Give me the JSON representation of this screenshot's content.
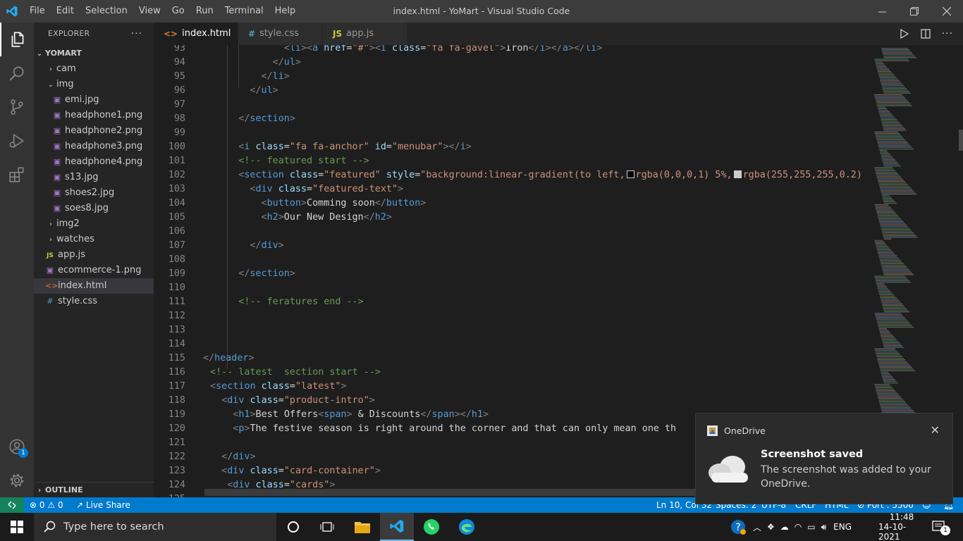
{
  "window": {
    "title": "index.html - YoMart - Visual Studio Code"
  },
  "menu": [
    "File",
    "Edit",
    "Selection",
    "View",
    "Go",
    "Run",
    "Terminal",
    "Help"
  ],
  "explorer": {
    "header": "EXPLORER",
    "project": "YOMART",
    "items": [
      {
        "label": "cam",
        "kind": "folder"
      },
      {
        "label": "img",
        "kind": "folder-open"
      },
      {
        "label": "emi.jpg",
        "kind": "image"
      },
      {
        "label": "headphone1.png",
        "kind": "image"
      },
      {
        "label": "headphone2.png",
        "kind": "image"
      },
      {
        "label": "headphone3.png",
        "kind": "image"
      },
      {
        "label": "headphone4.png",
        "kind": "image"
      },
      {
        "label": "s13.jpg",
        "kind": "image"
      },
      {
        "label": "shoes2.jpg",
        "kind": "image"
      },
      {
        "label": "soes8.jpg",
        "kind": "image"
      },
      {
        "label": "img2",
        "kind": "folder"
      },
      {
        "label": "watches",
        "kind": "folder"
      },
      {
        "label": "app.js",
        "kind": "js"
      },
      {
        "label": "ecommerce-1.png",
        "kind": "image"
      },
      {
        "label": "index.html",
        "kind": "html"
      },
      {
        "label": "style.css",
        "kind": "css"
      }
    ],
    "outline": "OUTLINE"
  },
  "tabs": [
    {
      "label": "index.html",
      "icon": "<>",
      "active": true
    },
    {
      "label": "style.css",
      "icon": "#",
      "active": false
    },
    {
      "label": "app.js",
      "icon": "JS",
      "active": false
    }
  ],
  "code_lines": [
    {
      "n": "93",
      "segs": [
        [
          "x",
          "        "
        ],
        [
          "p",
          "<"
        ],
        [
          "t",
          "li"
        ],
        [
          "p",
          ">"
        ],
        [
          "p",
          "<"
        ],
        [
          "t",
          "a"
        ],
        [
          "x",
          " "
        ],
        [
          "a",
          "href"
        ],
        [
          "x",
          "="
        ],
        [
          "s",
          "\"#\""
        ],
        [
          "p",
          ">"
        ],
        [
          "p",
          "<"
        ],
        [
          "t",
          "i"
        ],
        [
          "x",
          " "
        ],
        [
          "a",
          "class"
        ],
        [
          "x",
          "="
        ],
        [
          "s",
          "\"fa fa-gavel\""
        ],
        [
          "p",
          ">"
        ],
        [
          "x",
          "Iron"
        ],
        [
          "p",
          "</"
        ],
        [
          "t",
          "i"
        ],
        [
          "p",
          ">"
        ],
        [
          "p",
          "</"
        ],
        [
          "t",
          "a"
        ],
        [
          "p",
          ">"
        ],
        [
          "p",
          "</"
        ],
        [
          "t",
          "li"
        ],
        [
          "p",
          ">"
        ]
      ]
    },
    {
      "n": "94",
      "segs": [
        [
          "x",
          "      "
        ],
        [
          "p",
          "</"
        ],
        [
          "t",
          "ul"
        ],
        [
          "p",
          ">"
        ]
      ]
    },
    {
      "n": "95",
      "segs": [
        [
          "x",
          "    "
        ],
        [
          "p",
          "</"
        ],
        [
          "t",
          "li"
        ],
        [
          "p",
          ">"
        ]
      ]
    },
    {
      "n": "96",
      "segs": [
        [
          "x",
          "  "
        ],
        [
          "p",
          "</"
        ],
        [
          "t",
          "ul"
        ],
        [
          "p",
          ">"
        ]
      ]
    },
    {
      "n": "97",
      "segs": []
    },
    {
      "n": "98",
      "segs": [
        [
          "p",
          "</"
        ],
        [
          "t",
          "section"
        ],
        [
          "p",
          ">"
        ]
      ]
    },
    {
      "n": "99",
      "segs": []
    },
    {
      "n": "100",
      "segs": [
        [
          "p",
          "<"
        ],
        [
          "t",
          "i"
        ],
        [
          "x",
          " "
        ],
        [
          "a",
          "class"
        ],
        [
          "x",
          "="
        ],
        [
          "s",
          "\"fa fa-anchor\""
        ],
        [
          "x",
          " "
        ],
        [
          "a",
          "id"
        ],
        [
          "x",
          "="
        ],
        [
          "s",
          "\"menubar\""
        ],
        [
          "p",
          ">"
        ],
        [
          "p",
          "</"
        ],
        [
          "t",
          "i"
        ],
        [
          "p",
          ">"
        ]
      ]
    },
    {
      "n": "101",
      "segs": [
        [
          "c",
          "<!-- featured start -->"
        ]
      ]
    },
    {
      "n": "102",
      "segs": [
        [
          "p",
          "<"
        ],
        [
          "t",
          "section"
        ],
        [
          "x",
          " "
        ],
        [
          "a",
          "class"
        ],
        [
          "x",
          "="
        ],
        [
          "s",
          "\"featured\""
        ],
        [
          "x",
          " "
        ],
        [
          "a",
          "style"
        ],
        [
          "x",
          "="
        ],
        [
          "s",
          "\"background:linear-gradient(to left,"
        ],
        [
          "box",
          "#000000"
        ],
        [
          "s",
          "rgba(0,0,0,1) 5%,"
        ],
        [
          "box",
          "#cccccc"
        ],
        [
          "s",
          "rgba(255,255,255,0.2)"
        ]
      ]
    },
    {
      "n": "103",
      "segs": [
        [
          "x",
          "  "
        ],
        [
          "p",
          "<"
        ],
        [
          "t",
          "div"
        ],
        [
          "x",
          " "
        ],
        [
          "a",
          "class"
        ],
        [
          "x",
          "="
        ],
        [
          "s",
          "\"featured-text\""
        ],
        [
          "p",
          ">"
        ]
      ]
    },
    {
      "n": "104",
      "segs": [
        [
          "x",
          "    "
        ],
        [
          "p",
          "<"
        ],
        [
          "t",
          "button"
        ],
        [
          "p",
          ">"
        ],
        [
          "x",
          "Comming soon"
        ],
        [
          "p",
          "</"
        ],
        [
          "t",
          "button"
        ],
        [
          "p",
          ">"
        ]
      ]
    },
    {
      "n": "105",
      "segs": [
        [
          "x",
          "    "
        ],
        [
          "p",
          "<"
        ],
        [
          "t",
          "h2"
        ],
        [
          "p",
          ">"
        ],
        [
          "x",
          "Our New Design"
        ],
        [
          "p",
          "</"
        ],
        [
          "t",
          "h2"
        ],
        [
          "p",
          ">"
        ]
      ]
    },
    {
      "n": "106",
      "segs": []
    },
    {
      "n": "107",
      "segs": [
        [
          "x",
          "  "
        ],
        [
          "p",
          "</"
        ],
        [
          "t",
          "div"
        ],
        [
          "p",
          ">"
        ]
      ]
    },
    {
      "n": "108",
      "segs": []
    },
    {
      "n": "109",
      "segs": [
        [
          "p",
          "</"
        ],
        [
          "t",
          "section"
        ],
        [
          "p",
          ">"
        ]
      ]
    },
    {
      "n": "110",
      "segs": []
    },
    {
      "n": "111",
      "segs": [
        [
          "c",
          "<!-- feratures end -->"
        ]
      ]
    },
    {
      "n": "112",
      "segs": []
    },
    {
      "n": "113",
      "segs": []
    },
    {
      "n": "114",
      "segs": []
    },
    {
      "n": "115",
      "segs": [
        [
          "p",
          "</"
        ],
        [
          "t",
          "header"
        ],
        [
          "p",
          ">"
        ]
      ]
    },
    {
      "n": "116",
      "segs": [
        [
          "c",
          "<!-- latest  section start -->"
        ]
      ]
    },
    {
      "n": "117",
      "segs": [
        [
          "p",
          "<"
        ],
        [
          "t",
          "section"
        ],
        [
          "x",
          " "
        ],
        [
          "a",
          "class"
        ],
        [
          "x",
          "="
        ],
        [
          "s",
          "\"latest\""
        ],
        [
          "p",
          ">"
        ]
      ]
    },
    {
      "n": "118",
      "segs": [
        [
          "x",
          "  "
        ],
        [
          "p",
          "<"
        ],
        [
          "t",
          "div"
        ],
        [
          "x",
          " "
        ],
        [
          "a",
          "class"
        ],
        [
          "x",
          "="
        ],
        [
          "s",
          "\"product-intro\""
        ],
        [
          "p",
          ">"
        ]
      ]
    },
    {
      "n": "119",
      "segs": [
        [
          "x",
          "    "
        ],
        [
          "p",
          "<"
        ],
        [
          "t",
          "h1"
        ],
        [
          "p",
          ">"
        ],
        [
          "x",
          "Best Offers"
        ],
        [
          "p",
          "<"
        ],
        [
          "t",
          "span"
        ],
        [
          "p",
          ">"
        ],
        [
          "x",
          " & Discounts"
        ],
        [
          "p",
          "</"
        ],
        [
          "t",
          "span"
        ],
        [
          "p",
          ">"
        ],
        [
          "p",
          "</"
        ],
        [
          "t",
          "h1"
        ],
        [
          "p",
          ">"
        ]
      ]
    },
    {
      "n": "120",
      "segs": [
        [
          "x",
          "    "
        ],
        [
          "p",
          "<"
        ],
        [
          "t",
          "p"
        ],
        [
          "p",
          ">"
        ],
        [
          "x",
          "The festive season is right around the corner and that can only mean one th"
        ]
      ]
    },
    {
      "n": "121",
      "segs": []
    },
    {
      "n": "122",
      "segs": [
        [
          "x",
          "  "
        ],
        [
          "p",
          "</"
        ],
        [
          "t",
          "div"
        ],
        [
          "p",
          ">"
        ]
      ]
    },
    {
      "n": "123",
      "segs": [
        [
          "x",
          "  "
        ],
        [
          "p",
          "<"
        ],
        [
          "t",
          "div"
        ],
        [
          "x",
          " "
        ],
        [
          "a",
          "class"
        ],
        [
          "x",
          "="
        ],
        [
          "s",
          "\"card-container\""
        ],
        [
          "p",
          ">"
        ]
      ]
    },
    {
      "n": "124",
      "segs": [
        [
          "x",
          "   "
        ],
        [
          "p",
          "<"
        ],
        [
          "t",
          "div"
        ],
        [
          "x",
          " "
        ],
        [
          "a",
          "class"
        ],
        [
          "x",
          "="
        ],
        [
          "s",
          "\"cards\""
        ],
        [
          "p",
          ">"
        ]
      ]
    },
    {
      "n": "125",
      "segs": []
    }
  ],
  "status": {
    "errors": "0",
    "warnings": "0",
    "live_share": "Live Share",
    "cursor": "Ln 10, Col 32",
    "spaces": "Spaces: 2",
    "encoding": "UTF-8",
    "eol": "CRLF",
    "language": "HTML",
    "port": "Port : 5500"
  },
  "accounts_badge": "1",
  "toast": {
    "app": "OneDrive",
    "title": "Screenshot saved",
    "message": "The screenshot was added to your OneDrive."
  },
  "taskbar": {
    "search_placeholder": "Type here to search",
    "language": "ENG",
    "time": "11:48",
    "date": "14-10-2021",
    "notification_count": "1"
  },
  "colors": {
    "accent": "#007acc",
    "remote": "#16825d",
    "titlebar": "#3c3c3c",
    "activitybar": "#333333",
    "sidebar": "#252526",
    "editor": "#1e1e1e"
  }
}
